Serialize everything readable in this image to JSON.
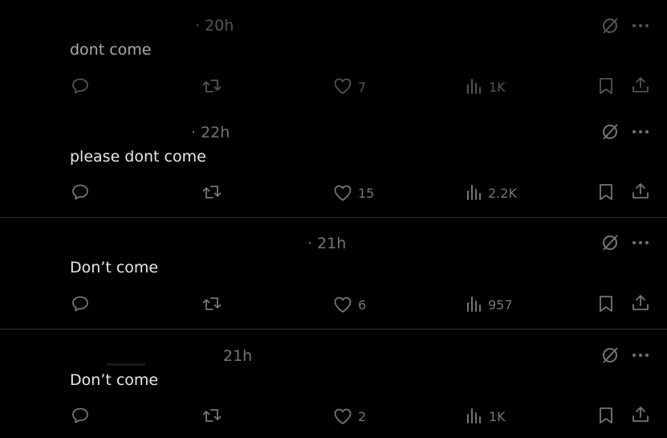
{
  "posts": [
    {
      "time": "· 20h",
      "text": "dont come",
      "likes": "7",
      "views": "1K"
    },
    {
      "time": "· 22h",
      "text": "please dont come",
      "likes": "15",
      "views": "2.2K"
    },
    {
      "time": "· 21h",
      "text": "Don’t come",
      "likes": "6",
      "views": "957"
    },
    {
      "time": "21h",
      "text": "Don’t come",
      "likes": "2",
      "views": "1K"
    }
  ],
  "colors": {
    "background": "#000000",
    "text": "#e7e9ea",
    "muted": "#71767b",
    "divider": "#2f3336"
  },
  "icons": {
    "grok": "grok-icon",
    "more": "more-icon",
    "reply": "reply-icon",
    "repost": "repost-icon",
    "like": "heart-icon",
    "views": "views-icon",
    "bookmark": "bookmark-icon",
    "share": "share-icon"
  }
}
